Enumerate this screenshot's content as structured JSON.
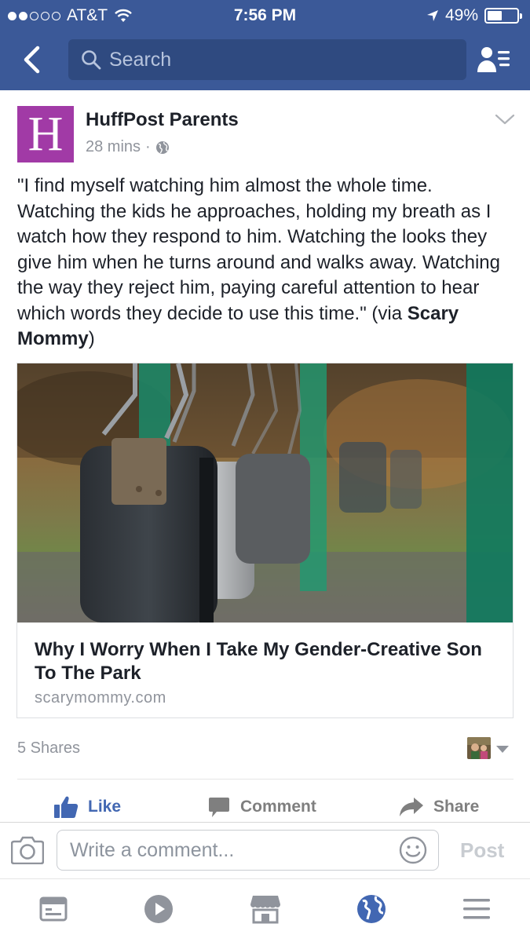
{
  "status_bar": {
    "carrier": "AT&T",
    "time": "7:56 PM",
    "battery": "49%",
    "battery_level": 0.49,
    "signal_bars_filled": 2,
    "signal_bars_total": 5
  },
  "search": {
    "placeholder": "Search"
  },
  "post": {
    "page_name": "HuffPost Parents",
    "avatar_letter": "H",
    "timestamp": "28 mins",
    "separator": "·",
    "text": "\"I find myself watching him almost the whole time. Watching the kids he approaches, holding my breath as I watch how they respond to him. Watching the looks they give him when he turns around and walks away. Watching the way they reject him, paying careful attention to hear which words they decide to use this time.\" (via ",
    "text_bold": "Scary Mommy",
    "text_end": ")",
    "link": {
      "title": "Why I Worry When I Take My Gender-Creative Son To The Park",
      "domain": "scarymommy.com"
    },
    "shares": "5 Shares"
  },
  "actions": {
    "like": "Like",
    "comment": "Comment",
    "share": "Share"
  },
  "comment_bar": {
    "placeholder": "Write a comment...",
    "post_label": "Post"
  },
  "tabs": [
    {
      "name": "news-feed",
      "icon": "news-feed-icon"
    },
    {
      "name": "video",
      "icon": "play-icon"
    },
    {
      "name": "marketplace",
      "icon": "marketplace-icon"
    },
    {
      "name": "notifications",
      "icon": "globe-icon",
      "active": true
    },
    {
      "name": "menu",
      "icon": "menu-icon"
    }
  ],
  "colors": {
    "header": "#3b5998",
    "accent": "#4267b2",
    "avatar": "#a13aa6"
  }
}
